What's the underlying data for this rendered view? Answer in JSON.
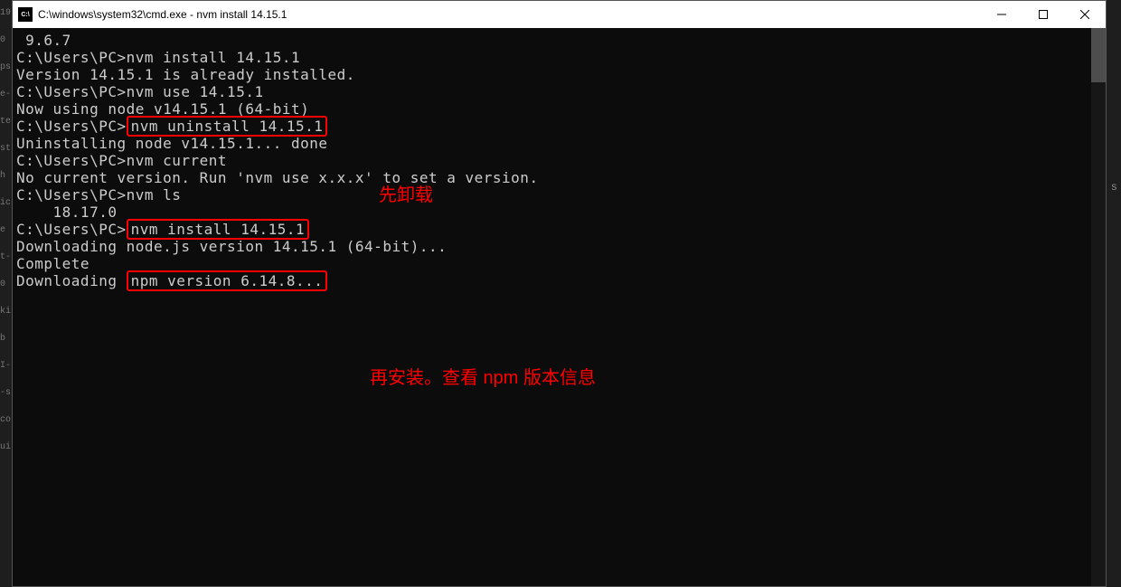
{
  "window": {
    "title": "C:\\windows\\system32\\cmd.exe - nvm  install 14.15.1",
    "icon_label": "C:\\"
  },
  "gutter": {
    "l0": "19",
    "l1": "0",
    "l2": "",
    "l3": "ps",
    "l4": "",
    "l5": "e-",
    "l6": "te",
    "l7": "st",
    "l8": "h",
    "l9": "ic",
    "l10": "e",
    "l11": "",
    "l12": "",
    "l13": "",
    "l14": "t-",
    "l15": "",
    "l16": "0",
    "l17": "",
    "l18": "ki",
    "l19": "b",
    "l20": "I-",
    "l21": "",
    "l22": "",
    "l23": "-s",
    "l24": "co",
    "l25": "",
    "l26": "ui"
  },
  "terminal": {
    "lines": [
      " 9.6.7",
      "",
      "C:\\Users\\PC>nvm install 14.15.1",
      "Version 14.15.1 is already installed.",
      "",
      "C:\\Users\\PC>nvm use 14.15.1",
      "Now using node v14.15.1 (64-bit)",
      "",
      "C:\\Users\\PC>",
      "Uninstalling node v14.15.1... done",
      "C:\\Users\\PC>nvm current",
      "No current version. Run 'nvm use x.x.x' to set a version.",
      "",
      "C:\\Users\\PC>nvm ls",
      "",
      "    18.17.0",
      "",
      "C:\\Users\\PC>",
      "Downloading node.js version 14.15.1 (64-bit)...",
      "Complete",
      "Downloading "
    ],
    "boxed": {
      "uninstall": "nvm uninstall 14.15.1",
      "install": "nvm install 14.15.1",
      "npm": "npm version 6.14.8..."
    }
  },
  "annotations": {
    "a1": "先卸载",
    "a2": "再安装。查看 npm 版本信息"
  },
  "right_edge": {
    "s": "s"
  }
}
